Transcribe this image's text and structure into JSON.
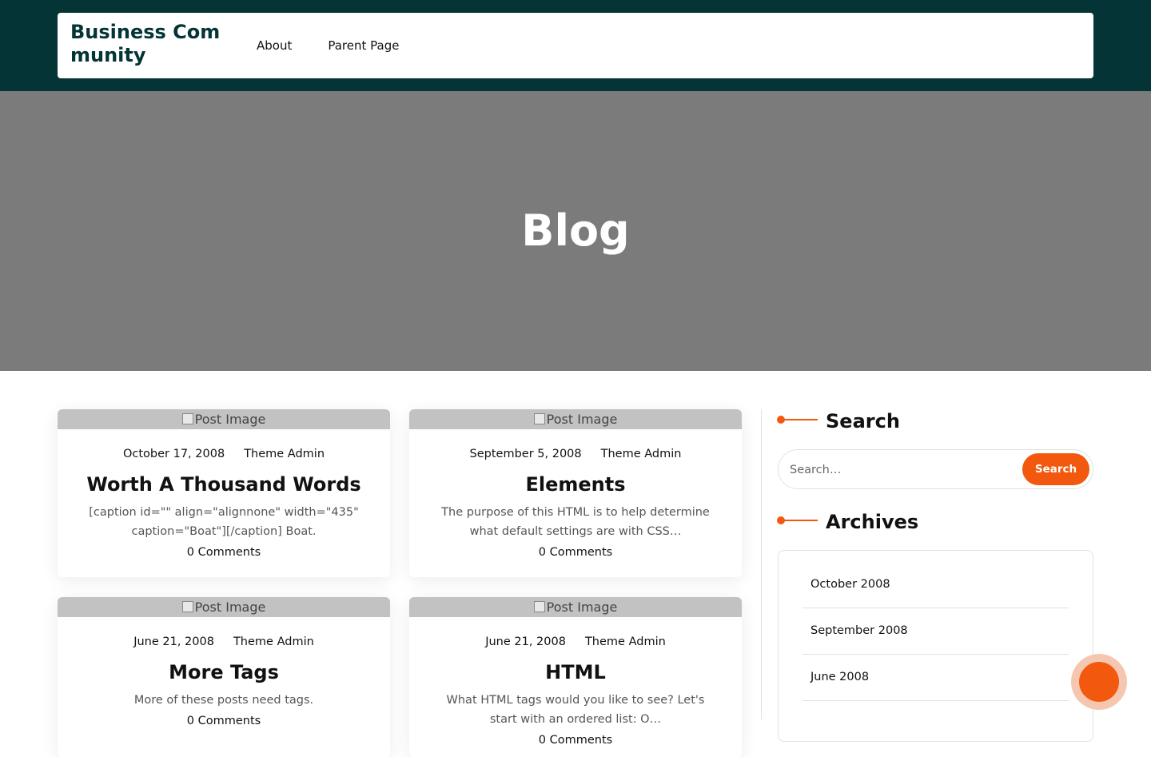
{
  "header": {
    "site_title": "Business Community",
    "nav": [
      {
        "label": "About"
      },
      {
        "label": "Parent Page"
      }
    ]
  },
  "banner": {
    "title": "Blog"
  },
  "posts": [
    {
      "image_alt": "Post Image",
      "date": "October 17, 2008",
      "author": "Theme Admin",
      "title": "Worth A Thousand Words",
      "excerpt": "[caption id=\"\" align=\"alignnone\" width=\"435\" caption=\"Boat\"][/caption] Boat.",
      "comments": "0 Comments"
    },
    {
      "image_alt": "Post Image",
      "date": "September 5, 2008",
      "author": "Theme Admin",
      "title": "Elements",
      "excerpt": "The purpose of this HTML is to help determine what default settings are with CSS…",
      "comments": "0 Comments"
    },
    {
      "image_alt": "Post Image",
      "date": "June 21, 2008",
      "author": "Theme Admin",
      "title": "More Tags",
      "excerpt": "More of these posts need tags.",
      "comments": "0 Comments"
    },
    {
      "image_alt": "Post Image",
      "date": "June 21, 2008",
      "author": "Theme Admin",
      "title": "HTML",
      "excerpt": "What HTML tags would you like to see? Let's start with an ordered list: O…",
      "comments": "0 Comments"
    }
  ],
  "sidebar": {
    "search": {
      "title": "Search",
      "placeholder": "Search…",
      "button_label": "Search"
    },
    "archives": {
      "title": "Archives",
      "items": [
        "October 2008",
        "September 2008",
        "June 2008"
      ]
    }
  },
  "colors": {
    "header_bg": "#043435",
    "accent": "#f2590e",
    "banner_bg": "#7b7b7b"
  },
  "icons": {
    "fab": "scroll-to-top-icon",
    "broken_image": "broken-image-icon"
  }
}
